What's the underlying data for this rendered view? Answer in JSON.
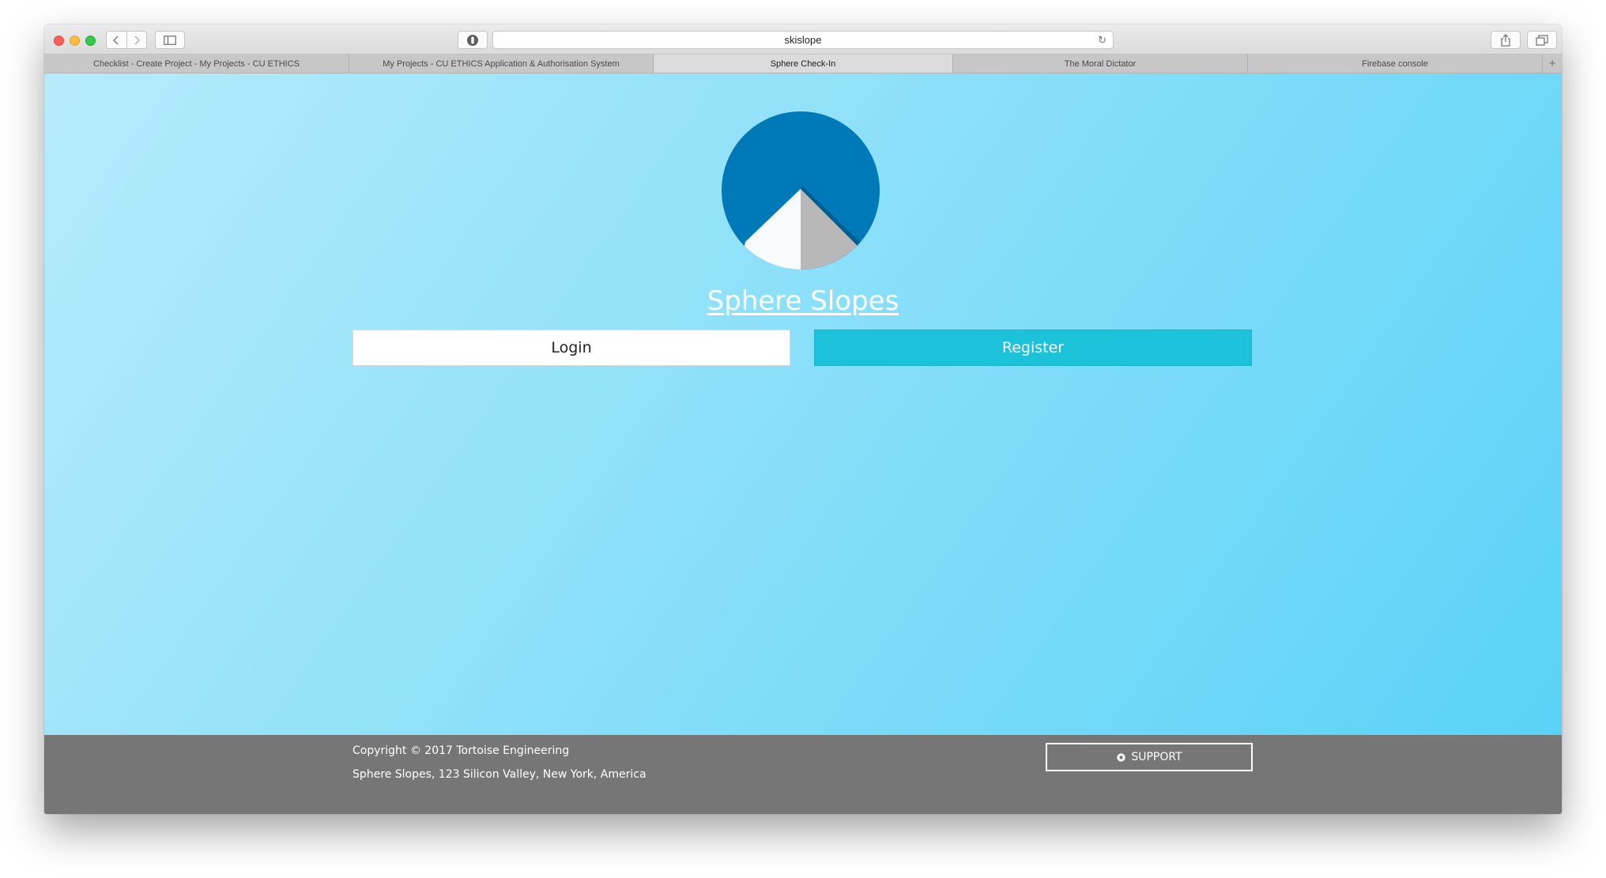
{
  "browser": {
    "url": "skislope",
    "tabs": [
      {
        "label": "Checklist - Create Project - My Projects - CU ETHICS",
        "active": false
      },
      {
        "label": "My Projects - CU ETHICS Application & Authorisation System",
        "active": false
      },
      {
        "label": "Sphere Check-In",
        "active": true
      },
      {
        "label": "The Moral Dictator",
        "active": false
      },
      {
        "label": "Firebase console",
        "active": false
      }
    ],
    "icons": {
      "back": "chevron-left-icon",
      "forward": "chevron-right-icon",
      "sidebar": "sidebar-icon",
      "privacy": "shield-icon",
      "reload": "reload-icon",
      "share": "share-icon",
      "tabs": "tab-overview-icon",
      "new_tab": "plus-icon"
    }
  },
  "page": {
    "title": "Sphere Slopes",
    "login_label": "Login",
    "register_label": "Register",
    "colors": {
      "logo_circle": "#0079b8",
      "mountain_light": "#f7fbfc",
      "mountain_shadow": "#b8b8b8",
      "register": "#1cc1da",
      "footer": "#767676"
    }
  },
  "footer": {
    "copyright": "Copyright © 2017 Tortoise Engineering",
    "address": "Sphere Slopes, 123 Silicon Valley, New York, America",
    "support_label": "SUPPORT",
    "support_icon": "gear-icon"
  }
}
